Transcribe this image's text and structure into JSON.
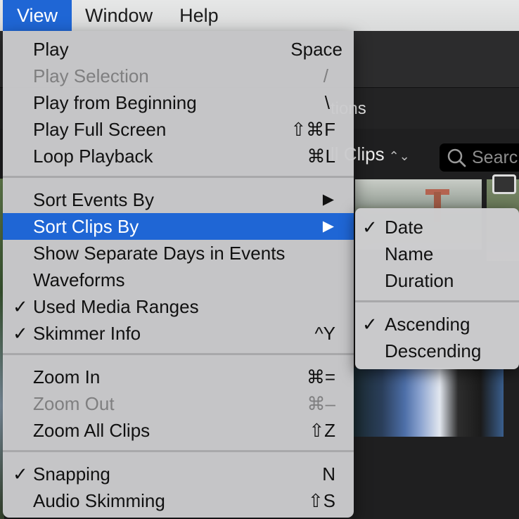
{
  "menubar": {
    "items": [
      "View",
      "Window",
      "Help"
    ],
    "active": "View",
    "accent": "#1f66d5"
  },
  "background_app": {
    "tab_label_fragment": "tions",
    "clips_popup_fragment": "ll Clips",
    "clips_popup_icon": "up-down-chevron-icon",
    "search_placeholder_fragment": "Searc",
    "search_icon": "magnifier-icon"
  },
  "view_menu": {
    "items": [
      {
        "label": "Play",
        "shortcut": "Space",
        "enabled": true,
        "checked": false
      },
      {
        "label": "Play Selection",
        "shortcut": "/",
        "enabled": false,
        "checked": false
      },
      {
        "label": "Play from Beginning",
        "shortcut": "\\",
        "enabled": true,
        "checked": false
      },
      {
        "label": "Play Full Screen",
        "shortcut": "⇧⌘F",
        "enabled": true,
        "checked": false
      },
      {
        "label": "Loop Playback",
        "shortcut": "⌘L",
        "enabled": true,
        "checked": false
      },
      {
        "label": "Sort Events By",
        "submenu": true,
        "enabled": true,
        "checked": false
      },
      {
        "label": "Sort Clips By",
        "submenu": true,
        "enabled": true,
        "checked": false,
        "highlighted": true
      },
      {
        "label": "Show Separate Days in Events",
        "enabled": true,
        "checked": false
      },
      {
        "label": "Waveforms",
        "enabled": true,
        "checked": false
      },
      {
        "label": "Used Media Ranges",
        "enabled": true,
        "checked": true
      },
      {
        "label": "Skimmer Info",
        "shortcut": "^Y",
        "enabled": true,
        "checked": true
      },
      {
        "label": "Zoom In",
        "shortcut": "⌘=",
        "enabled": true,
        "checked": false
      },
      {
        "label": "Zoom Out",
        "shortcut": "⌘–",
        "enabled": false,
        "checked": false
      },
      {
        "label": "Zoom All Clips",
        "shortcut": "⇧Z",
        "enabled": true,
        "checked": false
      },
      {
        "label": "Snapping",
        "shortcut": "N",
        "enabled": true,
        "checked": true
      },
      {
        "label": "Audio Skimming",
        "shortcut": "⇧S",
        "enabled": true,
        "checked": false
      }
    ],
    "check_glyph": "✓",
    "submenu_glyph": "▶"
  },
  "sort_clips_submenu": {
    "items": [
      {
        "label": "Date",
        "checked": true
      },
      {
        "label": "Name",
        "checked": false
      },
      {
        "label": "Duration",
        "checked": false
      },
      {
        "label": "Ascending",
        "checked": true
      },
      {
        "label": "Descending",
        "checked": false
      }
    ]
  }
}
